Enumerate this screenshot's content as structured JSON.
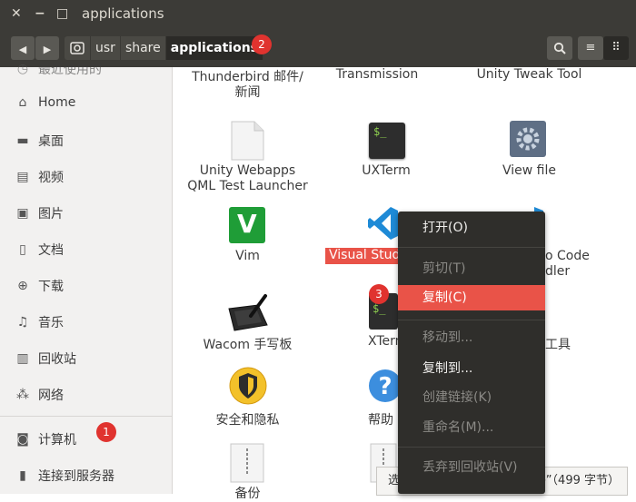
{
  "window": {
    "title": "applications",
    "close_glyph": "✕",
    "minimize_glyph": "−",
    "maximize_glyph": "□"
  },
  "toolbar": {
    "back_glyph": "◀",
    "forward_glyph": "▶",
    "breadcrumbs": [
      "usr",
      "share",
      "applications"
    ],
    "search_glyph": "🔍",
    "list_view_glyph": "≡",
    "grid_view_glyph": "⠿"
  },
  "badges": [
    "1",
    "2",
    "3"
  ],
  "sidebar": {
    "partial_top": "最近使用的",
    "items": [
      {
        "label": "Home",
        "icon": "home-icon",
        "glyph": "⌂"
      },
      {
        "label": "桌面",
        "icon": "folder-icon",
        "glyph": "▬"
      },
      {
        "label": "视频",
        "icon": "video-icon",
        "glyph": "▤"
      },
      {
        "label": "图片",
        "icon": "camera-icon",
        "glyph": "▣"
      },
      {
        "label": "文档",
        "icon": "document-icon",
        "glyph": "▯"
      },
      {
        "label": "下载",
        "icon": "download-icon",
        "glyph": "⊕"
      },
      {
        "label": "音乐",
        "icon": "music-icon",
        "glyph": "♫"
      },
      {
        "label": "回收站",
        "icon": "trash-icon",
        "glyph": "▥"
      },
      {
        "label": "网络",
        "icon": "network-icon",
        "glyph": "⁂"
      },
      {
        "label": "计算机",
        "icon": "computer-icon",
        "glyph": "◙"
      },
      {
        "label": "连接到服务器",
        "icon": "server-icon",
        "glyph": "▮"
      }
    ]
  },
  "files": {
    "row0": [
      "Thunderbird 邮件/",
      "新闻",
      "Transmission",
      "Unity Tweak Tool"
    ],
    "unity_webapps": [
      "Unity Webapps",
      "QML Test Launcher"
    ],
    "uxterm": "UXTerm",
    "view_file": "View file",
    "vim": "Vim",
    "visual_studio": "Visual Studio",
    "vscode_right": [
      "o Code",
      "dler"
    ],
    "wacom": "Wacom 手写板",
    "xterm": "XTerm",
    "tools_right": "工具",
    "security": "安全和隐私",
    "help": "帮助",
    "backup": "备份",
    "terminal_text": "$_"
  },
  "context_menu": {
    "open": "打开(O)",
    "cut": "剪切(T)",
    "copy": "复制(C)",
    "move_to": "移动到...",
    "copy_to": "复制到...",
    "create_link": "创建链接(K)",
    "rename": "重命名(M)...",
    "trash": "丢弃到回收站(V)"
  },
  "status": {
    "left": "选",
    "right": "e”（499 字节）"
  },
  "colors": {
    "accent": "#e95348",
    "badge": "#e0332f",
    "titlebar": "#3c3b37"
  }
}
